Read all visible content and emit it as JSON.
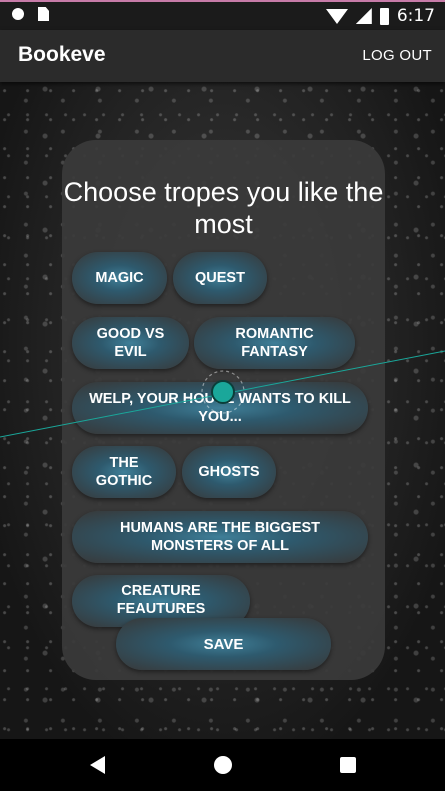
{
  "statusbar": {
    "time": "6:17",
    "icons": [
      "notification-dot-icon",
      "sd-card-icon",
      "wifi-icon",
      "signal-icon",
      "battery-icon"
    ]
  },
  "appbar": {
    "title": "Bookeve",
    "logout_label": "LOG OUT"
  },
  "card": {
    "title": "Choose tropes you like the most",
    "tropes": [
      "MAGIC",
      "QUEST",
      "GOOD VS EVIL",
      "ROMANTIC FANTASY",
      "WELP, YOUR HOUSE WANTS TO KILL YOU...",
      "THE GOTHIC",
      "GHOSTS",
      "HUMANS ARE THE BIGGEST MONSTERS OF ALL",
      "CREATURE FEAUTURES"
    ],
    "save_label": "SAVE"
  },
  "colors": {
    "accent": "#3f7f98",
    "touch_indicator": "#1aa79a",
    "appbar": "#2b2b2b"
  },
  "navbar": {
    "icons": [
      "back-icon",
      "home-icon",
      "recents-icon"
    ]
  }
}
